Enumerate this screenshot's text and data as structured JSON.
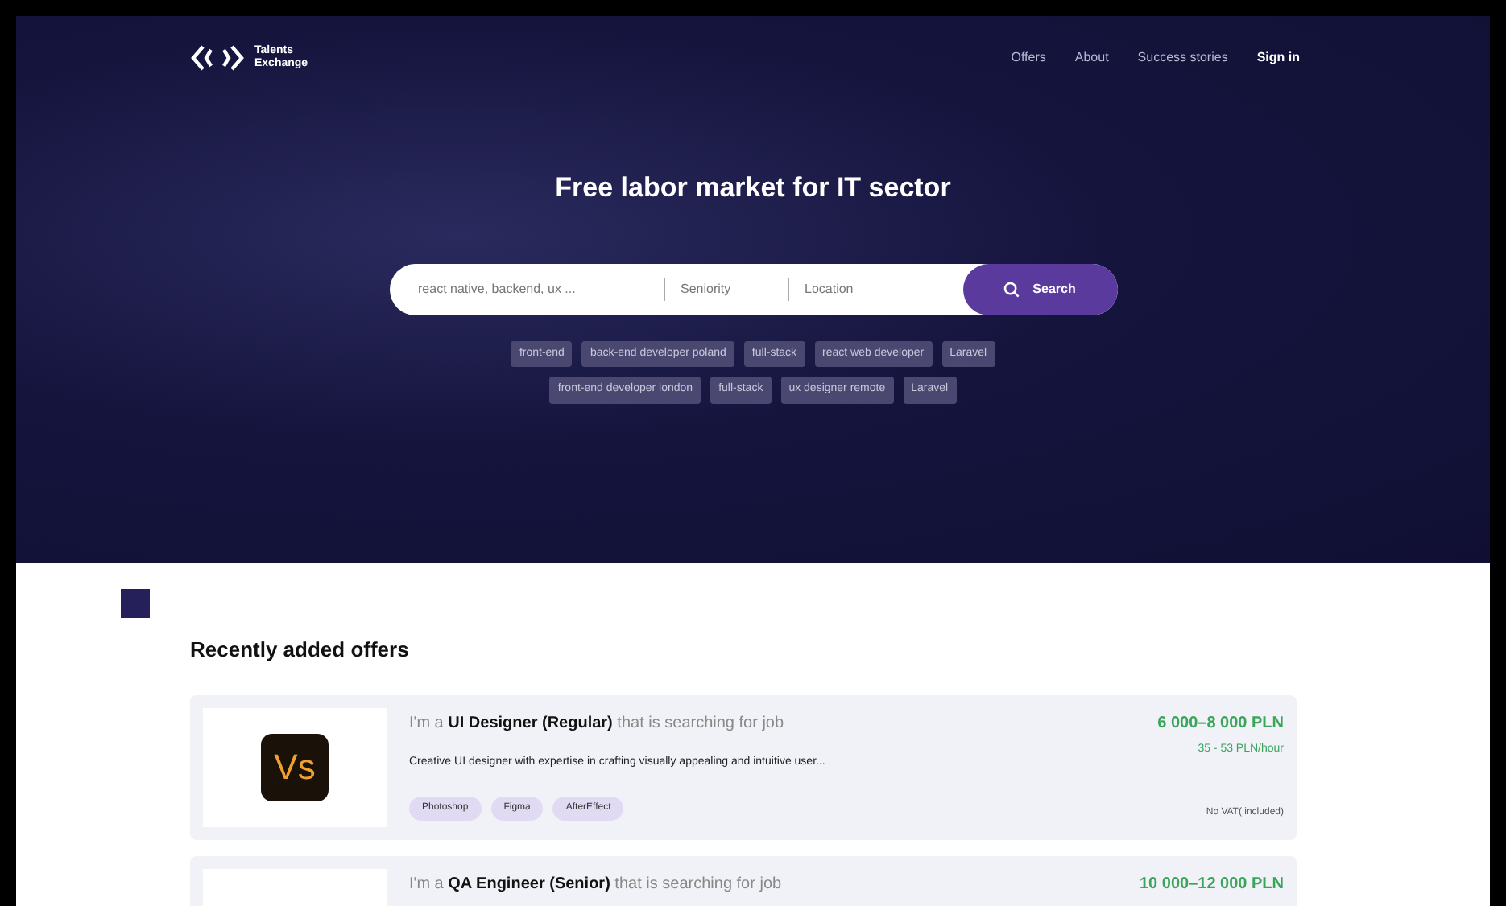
{
  "header": {
    "logo_text": [
      "Talents",
      "Exchange"
    ],
    "nav": [
      {
        "label": "Offers",
        "selected": false
      },
      {
        "label": "About",
        "selected": false
      },
      {
        "label": "Success stories",
        "selected": false
      },
      {
        "label": "Sign in",
        "selected": true
      }
    ]
  },
  "hero": {
    "title": "Free labor market for IT sector",
    "search": {
      "keywords_placeholder": "react native, backend, ux ...",
      "seniority_placeholder": "Seniority",
      "location_placeholder": "Location",
      "button": "Search"
    },
    "tag_rows": [
      [
        "front-end",
        "back-end developer poland",
        "full-stack",
        "react web developer",
        "Laravel"
      ],
      [
        "front-end developer london",
        "full-stack",
        "ux designer remote",
        "Laravel"
      ]
    ]
  },
  "offers": {
    "title": "Recently added offers",
    "items": [
      {
        "logo": {
          "kind": "lettermark",
          "text": "Vs"
        },
        "heading": "I'm a **UI Designer (Regular)** that is searching for job",
        "description": "Creative UI designer with expertise in crafting visually appealing and intuitive user...",
        "skills": [
          "Photoshop",
          "Figma",
          "AfterEffect"
        ],
        "salary": "6 000–8 000 PLN",
        "hourly": "35 - 53 PLN/hour",
        "vat": "No VAT( included)"
      },
      {
        "logo": {
          "kind": "placeholder"
        },
        "heading": "I'm a  **QA Engineer (Senior)** that is searching for job",
        "salary": "10 000–12 000 PLN"
      }
    ]
  }
}
